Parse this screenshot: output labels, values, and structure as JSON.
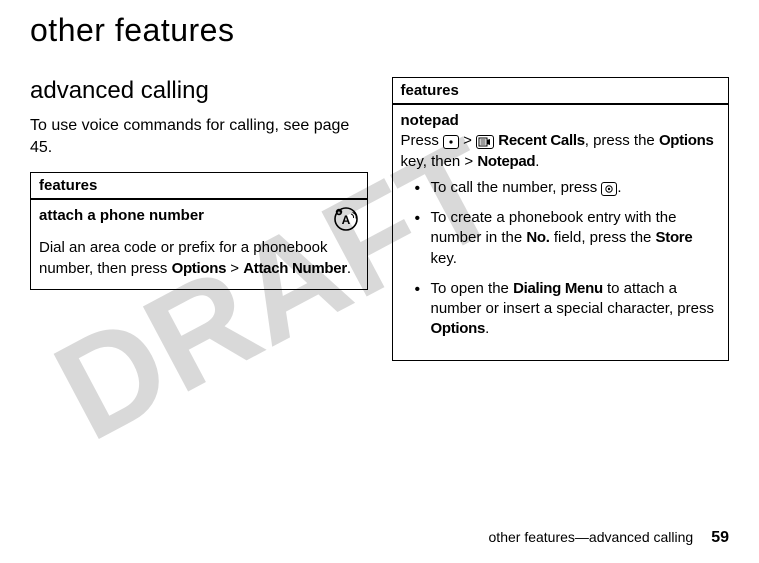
{
  "page_title": "other features",
  "watermark_text": "DRAFT",
  "left": {
    "heading": "advanced calling",
    "intro_a": "To use voice commands for calling, see page ",
    "intro_page_ref": "45",
    "intro_b": ".",
    "box": {
      "header": "features",
      "subtitle": "attach a phone number",
      "desc_a": "Dial an area code or prefix for a phonebook number, then press ",
      "options": "Options",
      "gt": " > ",
      "attach": "Attach Number",
      "desc_b": "."
    }
  },
  "right": {
    "box": {
      "header": "features",
      "subtitle": "notepad",
      "press": "Press ",
      "gt1": " > ",
      "recent_calls": "Recent Calls",
      "press2": ", press the ",
      "options": "Options",
      "press3": " key, then > ",
      "notepad": "Notepad",
      "period": ".",
      "b1_a": "To call the number, press ",
      "b1_b": ".",
      "b2_a": "To create a phonebook entry with the number in the ",
      "b2_no": "No.",
      "b2_b": " field, press the ",
      "b2_store": "Store",
      "b2_c": " key.",
      "b3_a": "To open the ",
      "b3_menu": "Dialing Menu",
      "b3_b": " to attach a number or insert a special character, press ",
      "b3_options": "Options",
      "b3_c": "."
    }
  },
  "footer": {
    "text": "other features—advanced calling",
    "page": "59"
  }
}
